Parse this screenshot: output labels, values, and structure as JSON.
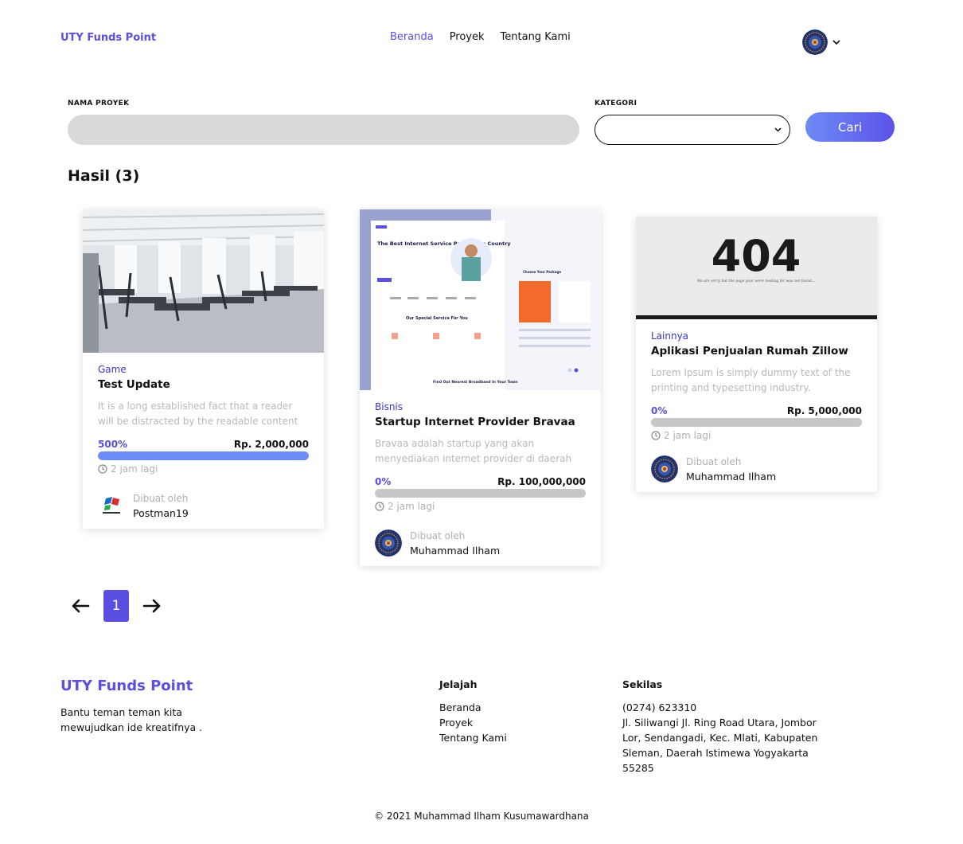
{
  "header": {
    "brand": "UTY Funds Point",
    "nav": [
      "Beranda",
      "Proyek",
      "Tentang Kami"
    ],
    "active_nav": "Beranda"
  },
  "search": {
    "name_label": "NAMA PROYEK",
    "name_value": "",
    "category_label": "KATEGORI",
    "category_value": "",
    "button": "Cari"
  },
  "results": {
    "title": "Hasil (3)",
    "cards": [
      {
        "category": "Game",
        "title": "Test Update",
        "description": "It is a long established fact that a reader will be distracted by the readable content",
        "percent_label": "500%",
        "progress_fraction": 1.0,
        "target": "Rp. 2,000,000",
        "time": "2 jam lagi",
        "created_by": "Dibuat oleh",
        "creator": "Postman19",
        "image": "gym-photo"
      },
      {
        "category": "Bisnis",
        "title": "Startup Internet Provider Bravaa",
        "description": "Bravaa adalah startup yang akan menyediakan internet provider di daerah",
        "percent_label": "0%",
        "progress_fraction": 0,
        "target": "Rp. 100,000,000",
        "time": "2 jam lagi",
        "created_by": "Dibuat oleh",
        "creator": "Muhammad Ilham",
        "image": "website-mockup",
        "mockup_texts": {
          "hero": "The Best Internet Service Provider In Country",
          "service": "Our Special Service For You",
          "find": "Find Out Nearest Broadband In Your Town",
          "package": "Choose Your Package"
        }
      },
      {
        "category": "Lainnya",
        "title": "Aplikasi Penjualan Rumah Zillow",
        "description": "Lorem Ipsum is simply dummy text of the printing and typesetting industry.",
        "percent_label": "0%",
        "progress_fraction": 0,
        "target": "Rp. 5,000,000",
        "time": "2 jam lagi",
        "created_by": "Dibuat oleh",
        "creator": "Muhammad Ilham",
        "image": "404-page",
        "image_texts": {
          "code": "404",
          "message": "We are sorry but the page your were looking for was not found..."
        }
      }
    ]
  },
  "pagination": {
    "current": "1",
    "prev_icon": "arrow-left-icon",
    "next_icon": "arrow-right-icon"
  },
  "footer": {
    "brand": "UTY Funds Point",
    "tagline": "Bantu teman teman kita mewujudkan ide kreatifnya .",
    "explore_title": "Jelajah",
    "explore_links": [
      "Beranda",
      "Proyek",
      "Tentang Kami"
    ],
    "about_title": "Sekilas",
    "phone": "(0274) 623310",
    "address": "Jl. Siliwangi Jl. Ring Road Utara, Jombor Lor, Sendangadi, Kec. Mlati, Kabupaten Sleman, Daerah Istimewa Yogyakarta 55285",
    "copyright": "© 2021 Muhammad Ilham Kusumawardhana"
  },
  "colors": {
    "accent": "#5a4fe0",
    "category": "#3a37c9",
    "progress_fill": "#6d8cf6",
    "progress_track": "#c7c7c7"
  }
}
